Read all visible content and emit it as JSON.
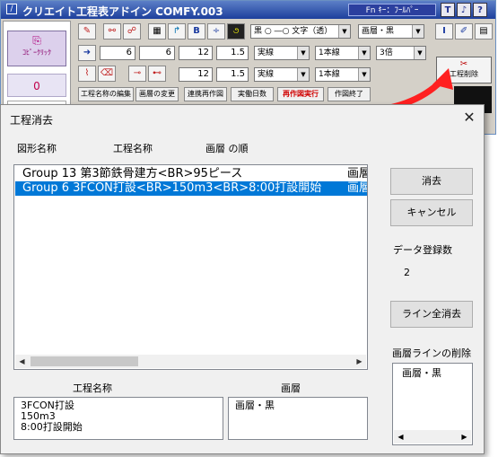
{
  "app": {
    "title": "クリエイト工程表アドイン COMFY.003",
    "fn_key_label": "Fn ｷｰ：ﾌｰﾙﾊﾟｰ",
    "title_buttons": [
      "T",
      "♪",
      "?"
    ],
    "copy_click_label": "ｺﾋﾟｰｸﾘｯｸ",
    "counter": "0",
    "fields_row1": [
      "6",
      "6",
      "12",
      "1.5"
    ],
    "fields_row2": [
      "12",
      "1.5"
    ],
    "combo_line_style": "実線",
    "combo_line_count": "1本線",
    "combo_scale": "3倍",
    "combo_marker": "黒 ○ ―○ 文字（透）",
    "combo_layer": "画層・黒",
    "row2_style": "実線",
    "row2_count": "1本線",
    "tab_labels": [
      "工程名称の編集",
      "画層の変更",
      "連携再作図",
      "実働日数",
      "再作図実行",
      "作図終了"
    ],
    "delete_tool_label": "工程削除"
  },
  "dialog": {
    "title": "工程消去",
    "close_glyph": "✕",
    "columns": [
      "図形名称",
      "工程名称",
      "画層 の順"
    ],
    "rows": [
      {
        "text": "Group 13  第3節鉄骨建方<BR>95ピース",
        "layer": "画層"
      },
      {
        "text": "Group 6  3FCON打設<BR>150m3<BR>8:00打設開始",
        "layer": "画層"
      }
    ],
    "selected_index": 1,
    "delete_button": "消去",
    "cancel_button": "キャンセル",
    "record_count_label": "データ登録数",
    "record_count": "2",
    "clear_all_button": "ライン全消去",
    "layer_line_delete_label": "画層ラインの削除",
    "layer_line_items": [
      "画層・黒"
    ],
    "detail_name_label": "工程名称",
    "detail_layer_label": "画層",
    "detail_name_lines": [
      "3FCON打設",
      "150m3",
      "8:00打設開始"
    ],
    "detail_layer_value": "画層・黒"
  }
}
